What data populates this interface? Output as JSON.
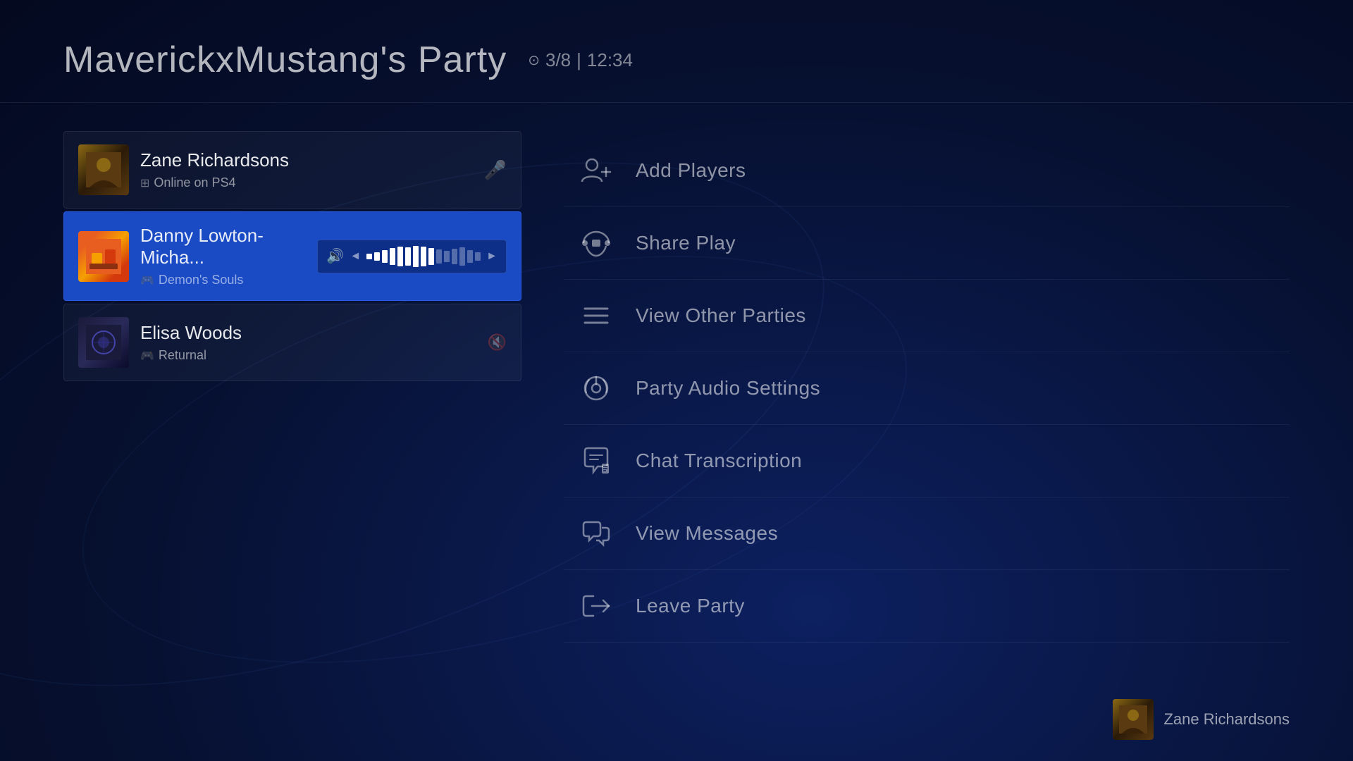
{
  "header": {
    "title": "MaverickxMustang's Party",
    "member_count": "3/8",
    "time": "12:34"
  },
  "members": [
    {
      "id": "zane",
      "name": "Zane Richardsons",
      "status": "Online on PS4",
      "status_prefix": "⊞",
      "active": false,
      "control": "mic"
    },
    {
      "id": "danny",
      "name": "Danny Lowton-Micha...",
      "status": "Demon's Souls",
      "status_prefix": "🎮",
      "active": true,
      "control": "volume"
    },
    {
      "id": "elisa",
      "name": "Elisa Woods",
      "status": "Returnal",
      "status_prefix": "🎮",
      "active": false,
      "control": "muted"
    }
  ],
  "menu": [
    {
      "id": "add-players",
      "label": "Add Players",
      "icon": "add-player"
    },
    {
      "id": "share-play",
      "label": "Share Play",
      "icon": "share-play"
    },
    {
      "id": "view-other-parties",
      "label": "View Other Parties",
      "icon": "view-parties"
    },
    {
      "id": "party-audio-settings",
      "label": "Party Audio Settings",
      "icon": "audio-settings"
    },
    {
      "id": "chat-transcription",
      "label": "Chat Transcription",
      "icon": "chat-transcription"
    },
    {
      "id": "view-messages",
      "label": "View Messages",
      "icon": "messages"
    },
    {
      "id": "leave-party",
      "label": "Leave Party",
      "icon": "leave"
    }
  ],
  "bottom_user": {
    "name": "Zane Richardsons"
  }
}
